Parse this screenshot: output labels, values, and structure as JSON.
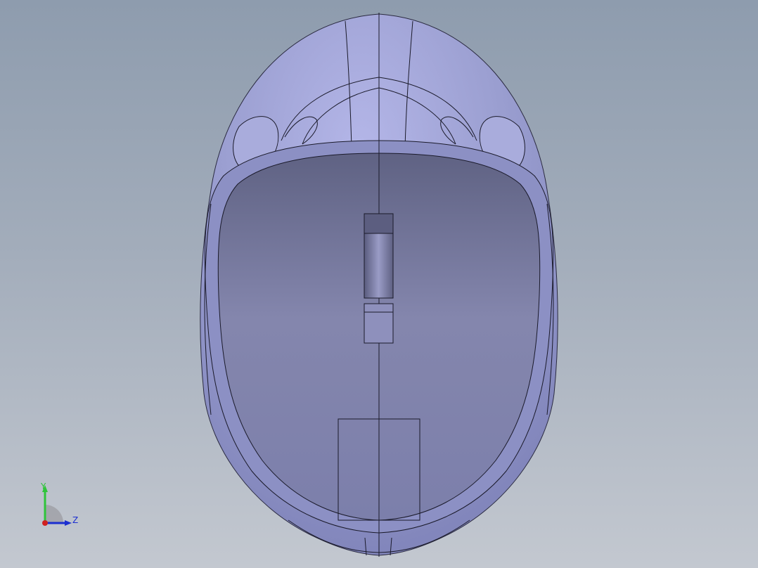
{
  "viewport": {
    "background_top": "#8e9cae",
    "background_bottom": "#c3c8d0"
  },
  "model": {
    "description_icon": "helmet-shell-model",
    "shell_color": "#9a9ed0",
    "inner_color": "#6f7195",
    "edge_color": "#1a1a2a"
  },
  "triad": {
    "y_label": "Y",
    "z_label": "Z",
    "y_color": "#2fc43a",
    "z_color": "#1c2fd0",
    "x_color": "#d02020"
  }
}
